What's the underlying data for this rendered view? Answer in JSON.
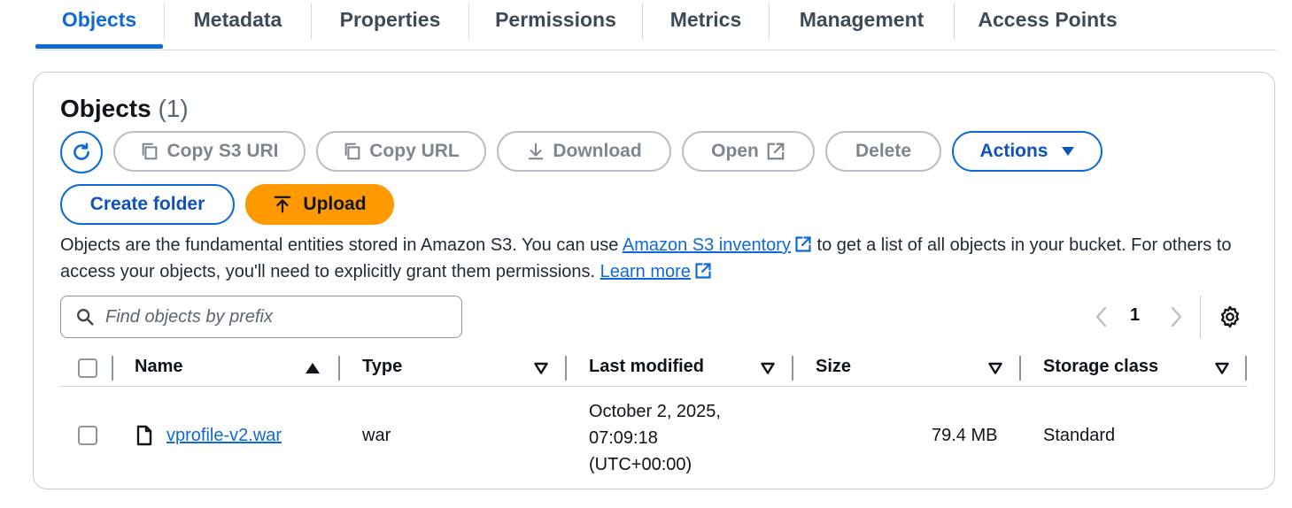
{
  "tabs": [
    {
      "label": "Objects",
      "active": true
    },
    {
      "label": "Metadata"
    },
    {
      "label": "Properties"
    },
    {
      "label": "Permissions"
    },
    {
      "label": "Metrics"
    },
    {
      "label": "Management"
    },
    {
      "label": "Access Points"
    }
  ],
  "panel": {
    "title": "Objects",
    "count": "(1)"
  },
  "toolbar": {
    "copy_s3_uri": "Copy S3 URI",
    "copy_url": "Copy URL",
    "download": "Download",
    "open": "Open",
    "delete": "Delete",
    "actions": "Actions",
    "create_folder": "Create folder",
    "upload": "Upload"
  },
  "description": {
    "part1": "Objects are the fundamental entities stored in Amazon S3. You can use ",
    "link1": "Amazon S3 inventory",
    "part2": " to get a list of all objects in your bucket. For others to access your objects, you'll need to explicitly grant them permissions. ",
    "link2": "Learn more"
  },
  "search": {
    "placeholder": "Find objects by prefix",
    "value": ""
  },
  "pagination": {
    "current_page": "1"
  },
  "table": {
    "columns": [
      "Name",
      "Type",
      "Last modified",
      "Size",
      "Storage class"
    ],
    "rows": [
      {
        "name": "vprofile-v2.war",
        "type": "war",
        "last_modified_line1": "October 2, 2025,",
        "last_modified_line2": "07:09:18",
        "last_modified_line3": "(UTC+00:00)",
        "size": "79.4 MB",
        "storage_class": "Standard"
      }
    ]
  },
  "colors": {
    "accent": "#0f6ad6",
    "upload": "#ff9900",
    "disabled": "#7d8690"
  },
  "icons": [
    "refresh-icon",
    "copy-icon",
    "download-icon",
    "external-link-icon",
    "caret-down-icon",
    "upload-icon",
    "search-icon",
    "chevron-left-icon",
    "chevron-right-icon",
    "gear-icon",
    "sort-asc-icon",
    "sort-desc-icon",
    "file-icon"
  ]
}
